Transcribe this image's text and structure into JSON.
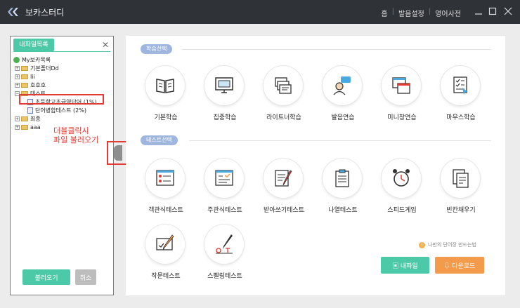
{
  "app": {
    "title": "보카스터디"
  },
  "topnav": {
    "home": "홈",
    "pron_settings": "발음설정",
    "dictionary": "영어사전"
  },
  "left_panel": {
    "tab_label": "내파일목록",
    "tree": [
      {
        "label": "My보카목록",
        "icon": "globe-icon"
      },
      {
        "label": "기본폴더Dd",
        "icon": "folder-icon"
      },
      {
        "label": "Iii",
        "icon": "folder-icon"
      },
      {
        "label": "호호호",
        "icon": "folder-icon"
      },
      {
        "label": "테스트",
        "icon": "folder-icon"
      },
      {
        "label": "초등학교초급영단어 (1%)",
        "icon": "file-icon"
      },
      {
        "label": "단어병합테스트 (2%)",
        "icon": "file-icon"
      },
      {
        "label": "최종",
        "icon": "folder-icon"
      },
      {
        "label": "aaa",
        "icon": "folder-icon"
      }
    ],
    "load_button": "불러오기",
    "cancel_button": "취소"
  },
  "annotation": {
    "line1": "더블클릭시",
    "line2": "파일 불러오기"
  },
  "sections": {
    "study": {
      "label": "학습선택",
      "items": [
        {
          "label": "기본학습",
          "icon": "book-icon"
        },
        {
          "label": "집중학습",
          "icon": "monitor-book-icon"
        },
        {
          "label": "라이트너학습",
          "icon": "cards-icon"
        },
        {
          "label": "발음연습",
          "icon": "speaker-person-icon"
        },
        {
          "label": "미니창연습",
          "icon": "mini-window-icon"
        },
        {
          "label": "마우스학습",
          "icon": "checklist-cursor-icon"
        }
      ]
    },
    "test": {
      "label": "테스트선택",
      "items": [
        {
          "label": "객관식테스트",
          "icon": "multiple-choice-icon"
        },
        {
          "label": "주관식테스트",
          "icon": "written-answer-icon"
        },
        {
          "label": "받아쓰기테스트",
          "icon": "dictation-icon"
        },
        {
          "label": "나열테스트",
          "icon": "clipboard-list-icon"
        },
        {
          "label": "스피드게임",
          "icon": "alarm-clock-icon"
        },
        {
          "label": "빈칸채우기",
          "icon": "blank-docs-icon"
        },
        {
          "label": "작문테스트",
          "icon": "pencil-check-icon"
        },
        {
          "label": "스펠링테스트",
          "icon": "spelling-pen-icon"
        }
      ]
    }
  },
  "footer": {
    "hint": "나만의 단어장 만드는법",
    "myfile_button": "내파일",
    "download_button": "다운로드"
  },
  "colors": {
    "accent": "#4cc9a6",
    "orange": "#f39a4b",
    "pill": "#9fb7de",
    "annotation": "#e53935"
  }
}
